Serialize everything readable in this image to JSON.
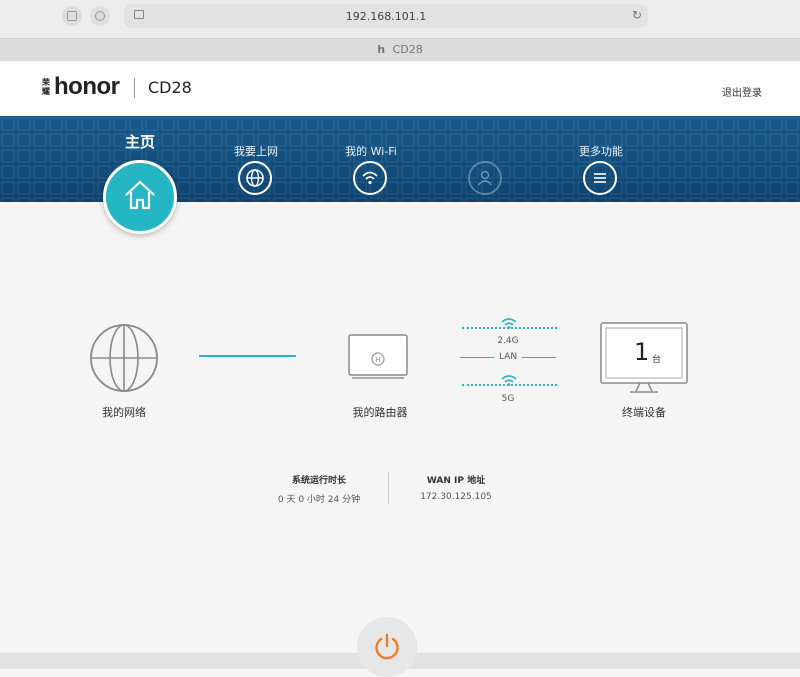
{
  "browser": {
    "url": "192.168.101.1",
    "tab_title": "CD28",
    "tab_icon": "h"
  },
  "header": {
    "brand_cn": "荣耀",
    "brand": "honor",
    "model": "CD28",
    "logout": "退出登录"
  },
  "nav": {
    "items": [
      {
        "label": "主页",
        "icon": "home-icon",
        "active": true
      },
      {
        "label": "我要上网",
        "icon": "globe-icon"
      },
      {
        "label": "我的 Wi-Fi",
        "icon": "wifi-icon"
      },
      {
        "label": "",
        "icon": "user-icon"
      },
      {
        "label": "更多功能",
        "icon": "menu-icon"
      }
    ]
  },
  "topology": {
    "network_label": "我的网络",
    "router_label": "我的路由器",
    "band_24g": "2.4G",
    "lan": "LAN",
    "band_5g": "5G",
    "device_count": "1",
    "device_unit": "台",
    "devices_label": "终端设备"
  },
  "stats": {
    "uptime_title": "系统运行时长",
    "uptime_value": "0 天 0 小时 24 分钟",
    "wan_title": "WAN IP 地址",
    "wan_value": "172.30.125.105"
  },
  "colors": {
    "accent": "#25b6c3",
    "nav_bg": "#13507f",
    "power": "#f07b2a"
  }
}
